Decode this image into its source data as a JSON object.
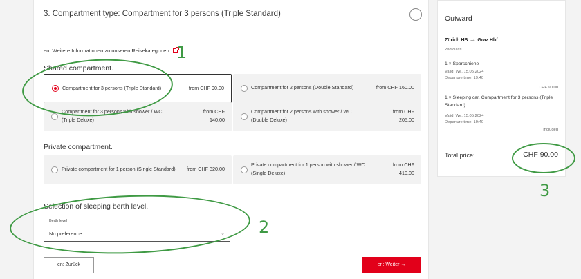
{
  "step": {
    "title": "3.  Compartment type: Compartment for 3 persons (Triple Standard)"
  },
  "info_link": {
    "label": "en: Weitere Informationen zu unseren Reisekategorien"
  },
  "shared": {
    "heading": "Shared compartment.",
    "options": [
      {
        "label": "Compartment for 3 persons (Triple Standard)",
        "price": "from CHF 90.00",
        "selected": true
      },
      {
        "label": "Compartment for 2 persons (Double Standard)",
        "price": "from CHF 160.00",
        "selected": false
      },
      {
        "label": "Compartment for 3 persons with shower / WC (Triple Deluxe)",
        "price": "from CHF 140.00",
        "selected": false
      },
      {
        "label": "Compartment for 2 persons with shower / WC (Double Deluxe)",
        "price": "from CHF 205.00",
        "selected": false
      }
    ]
  },
  "private": {
    "heading": "Private compartment.",
    "options": [
      {
        "label": "Private compartment for 1 person (Single Standard)",
        "price": "from CHF 320.00",
        "selected": false
      },
      {
        "label": "Private compartment for 1 person with shower / WC (Single Deluxe)",
        "price": "from CHF 410.00",
        "selected": false
      }
    ]
  },
  "berth": {
    "heading": "Selection of sleeping berth level.",
    "field_label": "Berth level",
    "value": "No preference"
  },
  "buttons": {
    "back": "en: Zurück",
    "next": "en: Weiter →"
  },
  "summary": {
    "title": "Outward",
    "route_from": "Zürich HB",
    "route_arrow": "→",
    "route_to": "Graz Hbf",
    "class": "2nd class",
    "item1_title": "1 × Sparschiene",
    "item1_valid": "Valid: We, 15.05.2024",
    "item1_departure": "Departure time: 19:40",
    "item1_price": "CHF 90.00",
    "item2_title": "1 × Sleeping car, Compartment for 3 persons (Triple Standard)",
    "item2_valid": "Valid: We, 15.05.2024",
    "item2_departure": "Departure time: 19:40",
    "item2_price": "included",
    "total_label": "Total price:",
    "total_value": "CHF 90.00"
  },
  "annotations": {
    "one": "1",
    "two": "2",
    "three": "3"
  },
  "colors": {
    "accent": "#e2001a",
    "annotation": "#3f9a44"
  }
}
